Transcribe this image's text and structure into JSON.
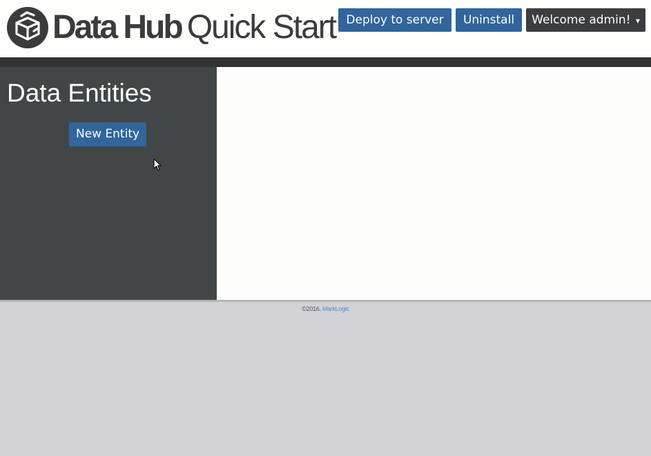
{
  "header": {
    "logo_bold": "Data Hub",
    "logo_light": "Quick Start",
    "deploy_label": "Deploy to server",
    "uninstall_label": "Uninstall",
    "welcome_label": "Welcome admin!",
    "caret": "▾"
  },
  "sidebar": {
    "title": "Data Entities",
    "new_entity_label": "New Entity"
  },
  "footer": {
    "copyright": "©2016.",
    "company_link": "MarkLogic"
  },
  "colors": {
    "primary_button": "#31659b",
    "dark_button": "#3c3d3f",
    "sidebar_bg": "#414646",
    "nav_bar": "#2f3333",
    "footer_bg": "#d3d3d6",
    "link": "#4a8fcf"
  },
  "icons": {
    "logo": "box-logo-icon",
    "cursor": "mouse-pointer-icon"
  }
}
